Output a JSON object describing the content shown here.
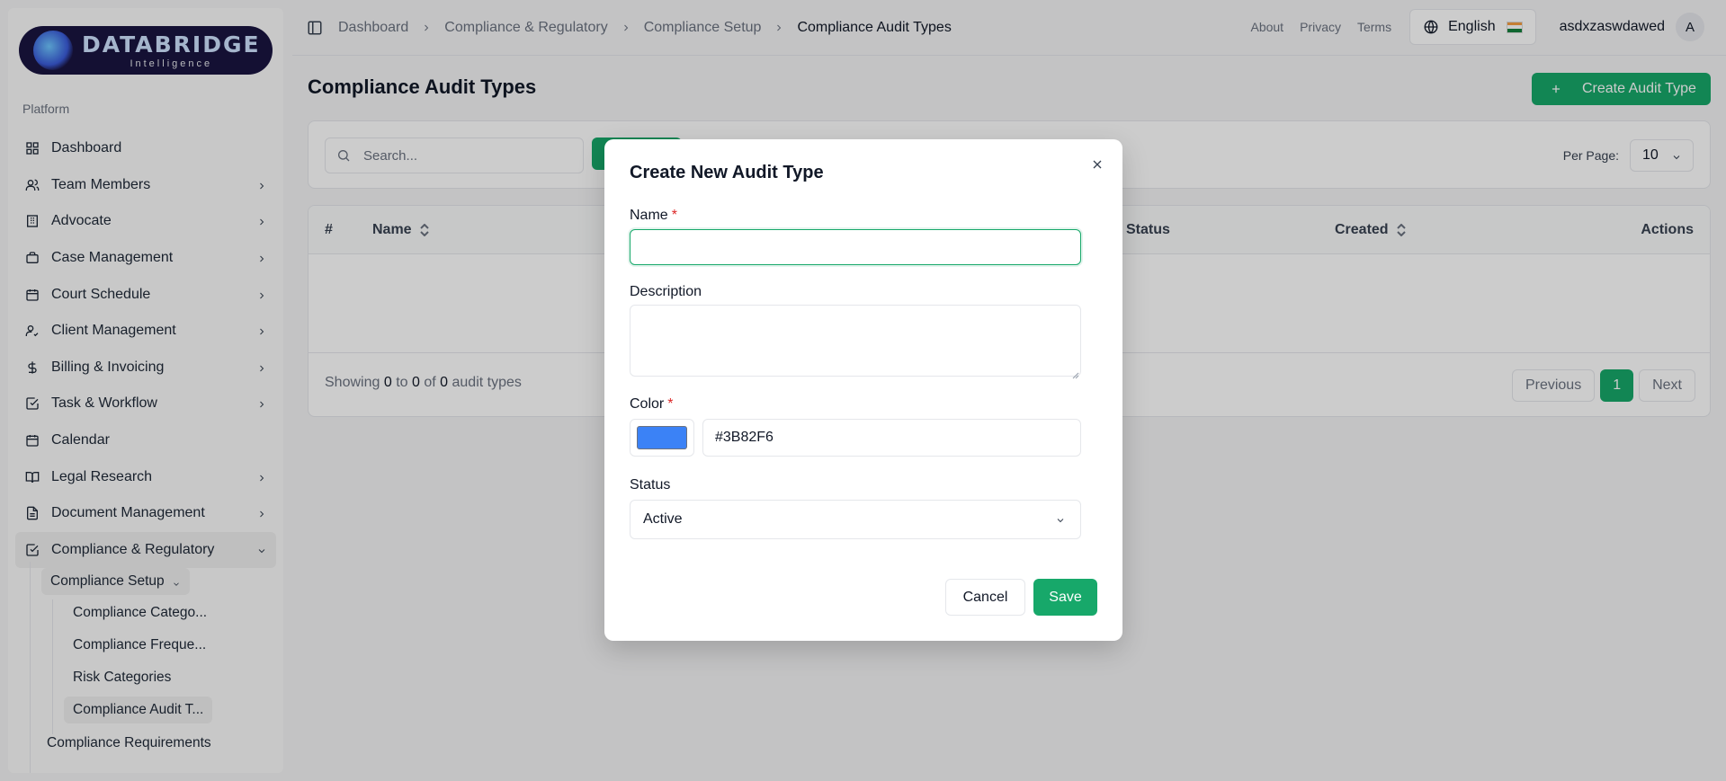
{
  "brand": {
    "title": "DATABRIDGE",
    "subtitle": "Intelligence"
  },
  "sidebar": {
    "section_label": "Platform",
    "items": [
      {
        "label": "Dashboard",
        "icon": "grid-icon",
        "chevron": false
      },
      {
        "label": "Team Members",
        "icon": "users-icon",
        "chevron": true
      },
      {
        "label": "Advocate",
        "icon": "building-icon",
        "chevron": true
      },
      {
        "label": "Case Management",
        "icon": "briefcase-icon",
        "chevron": true
      },
      {
        "label": "Court Schedule",
        "icon": "calendar-icon",
        "chevron": true
      },
      {
        "label": "Client Management",
        "icon": "user-check-icon",
        "chevron": true
      },
      {
        "label": "Billing & Invoicing",
        "icon": "dollar-icon",
        "chevron": true
      },
      {
        "label": "Task & Workflow",
        "icon": "check-square-icon",
        "chevron": true
      },
      {
        "label": "Calendar",
        "icon": "calendar-icon",
        "chevron": false
      },
      {
        "label": "Legal Research",
        "icon": "book-icon",
        "chevron": true
      },
      {
        "label": "Document Management",
        "icon": "file-icon",
        "chevron": true
      },
      {
        "label": "Compliance & Regulatory",
        "icon": "check-square-icon",
        "chevron": true
      }
    ],
    "sub": {
      "setup_label": "Compliance Setup",
      "setup_items": [
        "Compliance Catego...",
        "Compliance Freque...",
        "Risk Categories",
        "Compliance Audit T..."
      ],
      "requirements_label": "Compliance Requirements"
    }
  },
  "topbar": {
    "breadcrumb": [
      "Dashboard",
      "Compliance & Regulatory",
      "Compliance Setup",
      "Compliance Audit Types"
    ],
    "links": [
      "About",
      "Privacy",
      "Terms"
    ],
    "language": "English",
    "username": "asdxzaswdawed",
    "avatar_initial": "A"
  },
  "main": {
    "title": "Compliance Audit Types",
    "create_label": "Create Audit Type",
    "search_placeholder": "Search...",
    "per_page_label": "Per Page:",
    "per_page_value": "10",
    "columns": {
      "index": "#",
      "name": "Name",
      "status": "Status",
      "created": "Created",
      "actions": "Actions"
    },
    "showing": {
      "prefix": "Showing",
      "from": "0",
      "to_word": "to",
      "to": "0",
      "of_word": "of",
      "total": "0",
      "suffix": "audit types"
    },
    "pager": {
      "prev": "Previous",
      "page": "1",
      "next": "Next"
    }
  },
  "modal": {
    "title": "Create New Audit Type",
    "name_label": "Name",
    "name_value": "",
    "description_label": "Description",
    "description_value": "",
    "color_label": "Color",
    "color_value": "#3B82F6",
    "status_label": "Status",
    "status_value": "Active",
    "required_mark": "*",
    "cancel_label": "Cancel",
    "save_label": "Save"
  },
  "colors": {
    "accent": "#17a86a",
    "swatch": "#3B82F6",
    "required": "#dc2626"
  }
}
